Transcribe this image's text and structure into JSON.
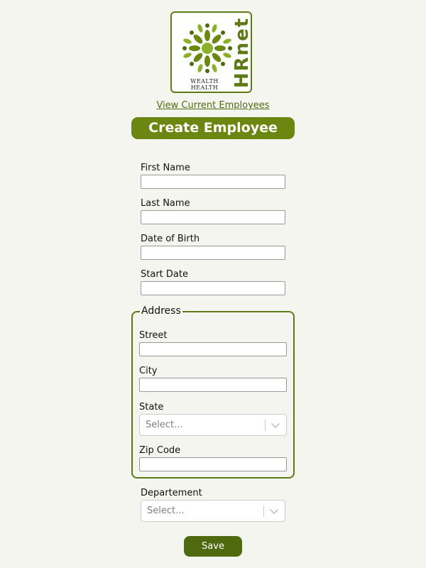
{
  "logo": {
    "brand": "HRnet",
    "tagline": "WEALTH HEALTH"
  },
  "nav": {
    "view_link": "View Current Employees"
  },
  "page": {
    "title": "Create Employee"
  },
  "form": {
    "first_name_label": "First Name",
    "first_name_value": "",
    "last_name_label": "Last Name",
    "last_name_value": "",
    "dob_label": "Date of Birth",
    "dob_value": "",
    "start_date_label": "Start Date",
    "start_date_value": "",
    "address": {
      "legend": "Address",
      "street_label": "Street",
      "street_value": "",
      "city_label": "City",
      "city_value": "",
      "state_label": "State",
      "state_placeholder": "Select...",
      "zip_label": "Zip Code",
      "zip_value": ""
    },
    "department_label": "Departement",
    "department_placeholder": "Select...",
    "save_label": "Save"
  },
  "icons": {
    "logo_mark": "tree-of-people-icon",
    "select_chevron": "chevron-down-icon"
  },
  "colors": {
    "brand_green": "#5e7a17",
    "title_bg": "#6b8712",
    "button_bg": "#4f6a0e",
    "page_bg": "#f5f5f0"
  }
}
